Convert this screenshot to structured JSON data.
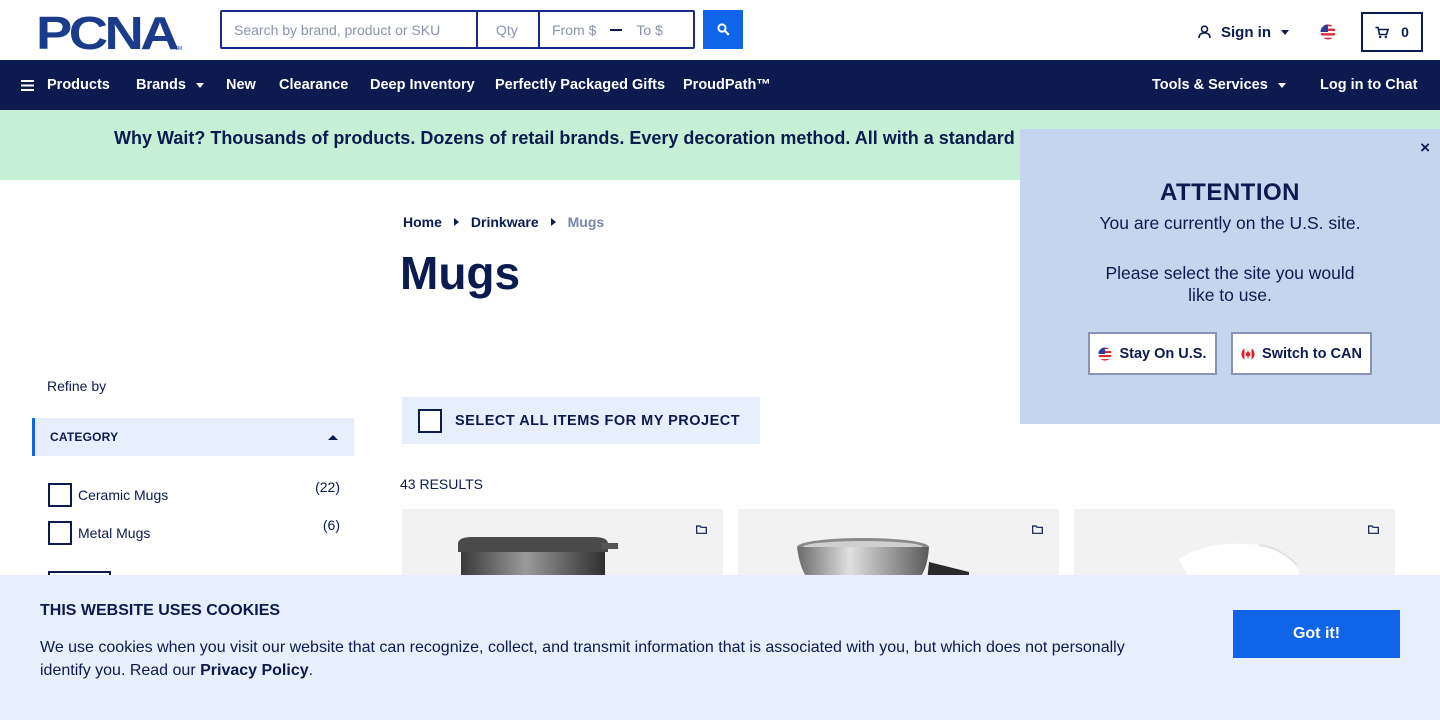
{
  "header": {
    "logo_text": "PCNA",
    "search": {
      "placeholder": "Search by brand, product or SKU",
      "qty_placeholder": "Qty",
      "from_placeholder": "From $",
      "to_placeholder": "To $"
    },
    "sign_in_label": "Sign in",
    "cart_count": "0"
  },
  "nav": {
    "products": "Products",
    "brands": "Brands",
    "new": "New",
    "clearance": "Clearance",
    "deep_inventory": "Deep Inventory",
    "perfectly_packaged_gifts": "Perfectly Packaged Gifts",
    "proudpath": "ProudPath™",
    "tools_services": "Tools & Services",
    "log_in_chat": "Log in to Chat"
  },
  "promo": {
    "text": "Why Wait? Thousands of products. Dozens of retail brands. Every decoration method. All with a standard"
  },
  "breadcrumb": {
    "home": "Home",
    "drinkware": "Drinkware",
    "current": "Mugs"
  },
  "page_title": "Mugs",
  "sidebar": {
    "refine_by": "Refine by",
    "category_header": "CATEGORY",
    "categories": [
      {
        "label": "Ceramic Mugs",
        "count": "(22)"
      },
      {
        "label": "Metal Mugs",
        "count": "(6)"
      }
    ]
  },
  "main": {
    "select_all": "SELECT ALL ITEMS FOR MY PROJECT",
    "results": "43 RESULTS"
  },
  "attention": {
    "title": "ATTENTION",
    "line1": "You are currently on the U.S. site.",
    "line2": "Please select the site you would like to use.",
    "stay_us": "Stay On U.S.",
    "switch_can": "Switch to CAN",
    "close": "×"
  },
  "cookie": {
    "heading": "THIS WEBSITE USES COOKIES",
    "body": "We use cookies when you visit our website that can recognize, collect, and transmit information that is associated with you, but which does not personally identify you. Read our ",
    "link": "Privacy Policy",
    "end": ".",
    "button": "Got it!"
  },
  "colors": {
    "navy": "#0b1a4f",
    "blue": "#1064e8",
    "promo_bg": "#c6f0d6",
    "attention_bg": "#c5d5ee",
    "light_blue": "#e7eefc"
  },
  "icons": [
    "search-icon",
    "user-icon",
    "us-flag-icon",
    "cart-icon",
    "menu-icon",
    "canada-flag-icon",
    "folder-icon",
    "close-icon"
  ]
}
